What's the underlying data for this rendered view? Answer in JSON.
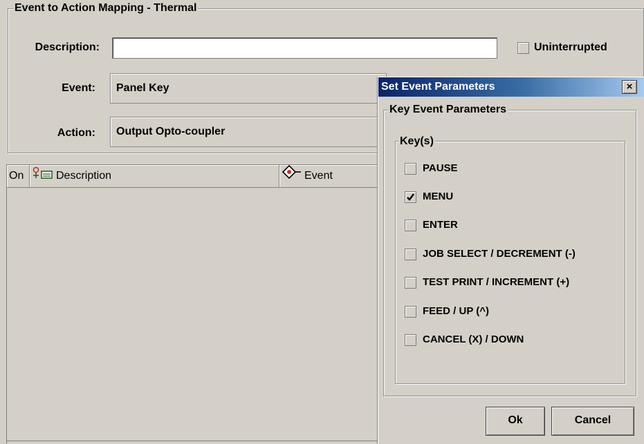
{
  "mapping_panel": {
    "title": "Event to Action Mapping - Thermal",
    "description_label": "Description:",
    "description_value": "",
    "uninterrupted_label": "Uninterrupted",
    "uninterrupted_checked": false,
    "event_label": "Event:",
    "event_value": "Panel Key",
    "action_label": "Action:",
    "action_value": "Output Opto-coupler"
  },
  "table": {
    "columns": [
      {
        "label": "On",
        "icon": ""
      },
      {
        "label": "Description",
        "icon": "description-column-icon"
      },
      {
        "label": "Event",
        "icon": "event-diamond-icon"
      }
    ]
  },
  "dialog": {
    "title": "Set Event Parameters",
    "close_glyph": "×",
    "group_title": "Key Event Parameters",
    "keys_title": "Key(s)",
    "keys": [
      {
        "label": "PAUSE",
        "checked": false
      },
      {
        "label": "MENU",
        "checked": true
      },
      {
        "label": "ENTER",
        "checked": false
      },
      {
        "label": "JOB SELECT / DECREMENT (-)",
        "checked": false
      },
      {
        "label": "TEST PRINT / INCREMENT (+)",
        "checked": false
      },
      {
        "label": "FEED / UP (^)",
        "checked": false
      },
      {
        "label": "CANCEL (X) / DOWN",
        "checked": false
      }
    ],
    "ok_label": "Ok",
    "cancel_label": "Cancel"
  }
}
